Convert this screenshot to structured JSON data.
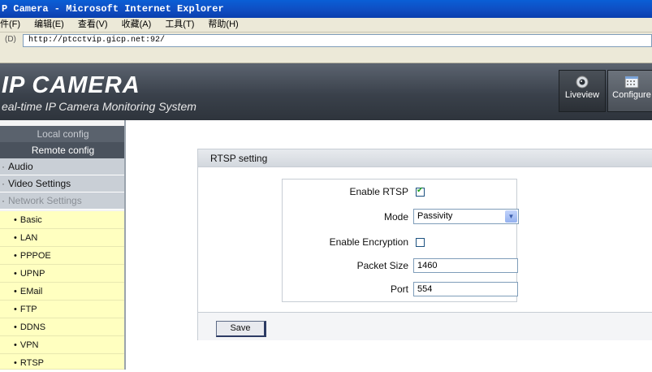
{
  "browser": {
    "title": "P Camera - Microsoft Internet Explorer",
    "menu": [
      "件(F)",
      "编辑(E)",
      "查看(V)",
      "收藏(A)",
      "工具(T)",
      "帮助(H)"
    ],
    "address_icon": "(D)",
    "address": "http://ptcctvip.gicp.net:92/"
  },
  "header": {
    "title": "IP CAMERA",
    "subtitle": "eal-time IP Camera Monitoring  System",
    "buttons": [
      {
        "label": "Liveview",
        "icon": "camera-icon"
      },
      {
        "label": "Configure",
        "icon": "calendar-icon"
      }
    ]
  },
  "sidebar": {
    "local_config": "Local config",
    "remote_config": "Remote config",
    "sections": [
      "Audio",
      "Video Settings",
      "Network Settings"
    ],
    "items": [
      "Basic",
      "LAN",
      "PPPOE",
      "UPNP",
      "EMail",
      "FTP",
      "DDNS",
      "VPN",
      "RTSP"
    ],
    "bullet": "•"
  },
  "rtsp": {
    "panel_title": "RTSP setting",
    "enable_rtsp_label": "Enable RTSP",
    "enable_rtsp": true,
    "mode_label": "Mode",
    "mode_value": "Passivity",
    "enable_encryption_label": "Enable Encryption",
    "enable_encryption": false,
    "packet_size_label": "Packet Size",
    "packet_size": "1460",
    "port_label": "Port",
    "port": "554",
    "save_label": "Save"
  }
}
